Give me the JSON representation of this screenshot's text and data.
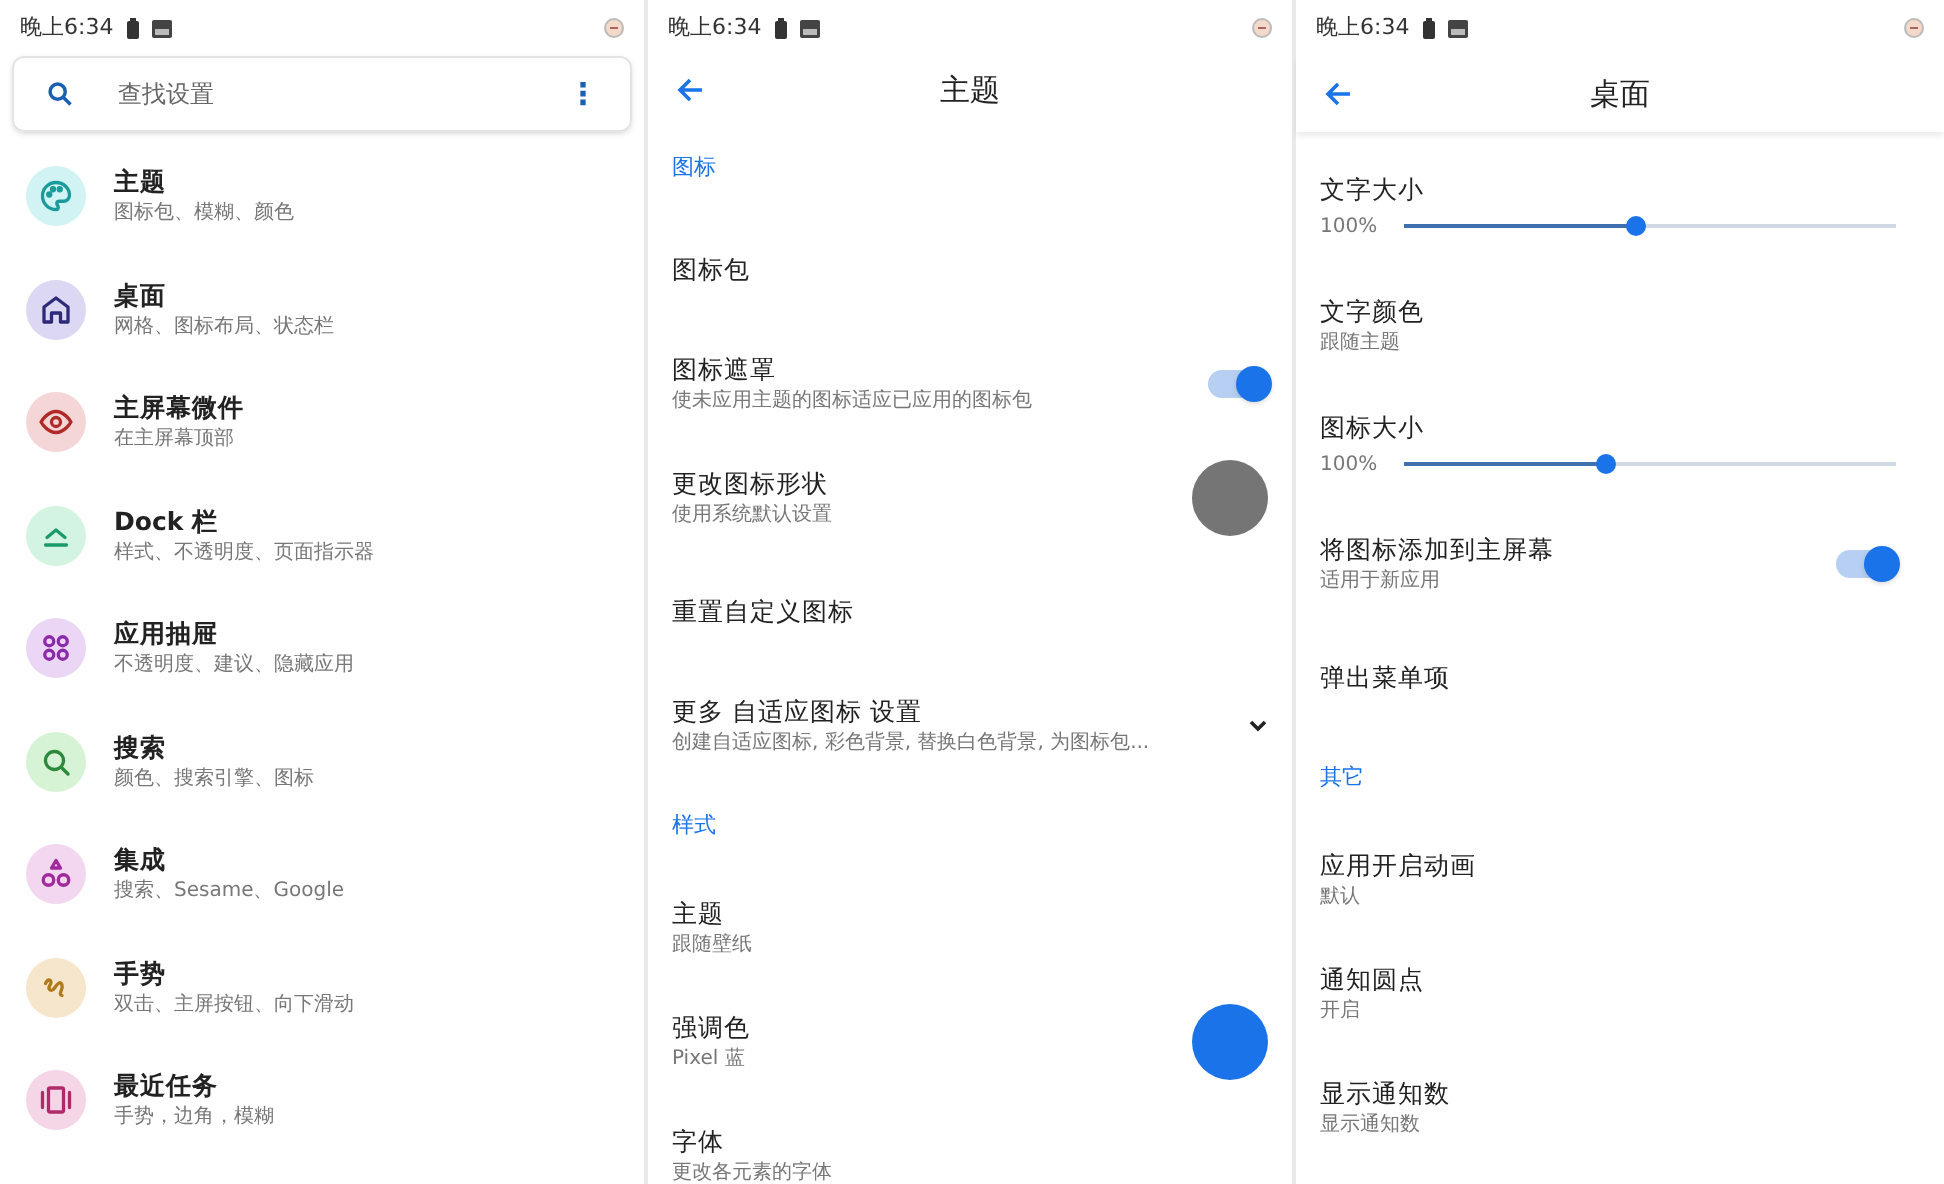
{
  "panels": [
    {
      "status_bar": {
        "time": "晚上6:34"
      },
      "search": {
        "placeholder": "查找设置",
        "menu": "⋮"
      },
      "items": [
        {
          "title": "主题",
          "subtitle": "图标包、模糊、颜色",
          "color": "#1a9a9a"
        },
        {
          "title": "桌面",
          "subtitle": "网格、图标布局、状态栏",
          "color": "#2e2a7a"
        },
        {
          "title": "主屏幕微件",
          "subtitle": "在主屏幕顶部",
          "color": "#b02a2a"
        },
        {
          "title": "Dock 栏",
          "subtitle": "样式、不透明度、页面指示器",
          "color": "#1a9a6a"
        },
        {
          "title": "应用抽屉",
          "subtitle": "不透明度、建议、隐藏应用",
          "color": "#8a2aaa"
        },
        {
          "title": "搜索",
          "subtitle": "颜色、搜索引擎、图标",
          "color": "#2a8a3a"
        },
        {
          "title": "集成",
          "subtitle": "搜索、Sesame、Google",
          "color": "#a02a9a"
        },
        {
          "title": "手势",
          "subtitle": "双击、主屏按钮、向下滑动",
          "color": "#b07a1a"
        },
        {
          "title": "最近任务",
          "subtitle": "手势，边角，模糊",
          "color": "#b02a6a"
        }
      ]
    },
    {
      "status_bar": {
        "time": "晚上6:34"
      },
      "title": "主题",
      "items": [
        {
          "kind": "header",
          "title": "图标"
        },
        {
          "kind": "plain",
          "title": "图标包"
        },
        {
          "kind": "toggle",
          "title": "图标遮罩",
          "subtitle": "使未应用主题的图标适应已应用的图标包",
          "on": true
        },
        {
          "kind": "swatch",
          "title": "更改图标形状",
          "subtitle": "使用系统默认设置",
          "color": "#757575"
        },
        {
          "kind": "plain",
          "title": "重置自定义图标"
        },
        {
          "kind": "expand",
          "title": "更多 自适应图标 设置",
          "subtitle": "创建自适应图标, 彩色背景, 替换白色背景, 为图标包...",
          "expanded": false
        },
        {
          "kind": "header",
          "title": "样式"
        },
        {
          "kind": "plain",
          "title": "主题",
          "subtitle": "跟随壁纸"
        },
        {
          "kind": "swatch",
          "title": "强调色",
          "subtitle": "Pixel 蓝",
          "color": "#1a73e8"
        },
        {
          "kind": "plain",
          "title": "字体",
          "subtitle": "更改各元素的字体"
        }
      ]
    },
    {
      "status_bar": {
        "time": "晚上6:34"
      },
      "title": "桌面",
      "items": [
        {
          "kind": "slider",
          "title": "文字大小",
          "reading": "100%",
          "level": 0.47
        },
        {
          "kind": "plain",
          "title": "文字颜色",
          "subtitle": "跟随主题"
        },
        {
          "kind": "slider",
          "title": "图标大小",
          "reading": "100%",
          "level": 0.41
        },
        {
          "kind": "toggle",
          "title": "将图标添加到主屏幕",
          "subtitle": "适用于新应用",
          "on": true
        },
        {
          "kind": "plain",
          "title": "弹出菜单项"
        },
        {
          "kind": "header",
          "title": "其它"
        },
        {
          "kind": "plain",
          "title": "应用开启动画",
          "subtitle": "默认"
        },
        {
          "kind": "plain",
          "title": "通知圆点",
          "subtitle": "开启"
        },
        {
          "kind": "plain",
          "title": "显示通知数",
          "subtitle": "显示通知数"
        }
      ]
    }
  ]
}
